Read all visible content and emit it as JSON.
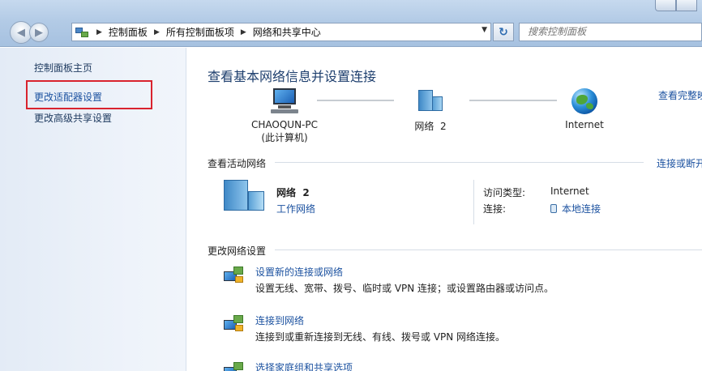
{
  "address_bar": {
    "breadcrumbs": [
      "控制面板",
      "所有控制面板项",
      "网络和共享中心"
    ]
  },
  "search": {
    "placeholder": "搜索控制面板"
  },
  "sidebar": {
    "home": "控制面板主页",
    "links": [
      "更改适配器设置",
      "更改高级共享设置"
    ]
  },
  "main": {
    "title": "查看基本网络信息并设置连接",
    "view_full_map": "查看完整映",
    "map": {
      "computer_name": "CHAOQUN-PC",
      "computer_sub": "(此计算机)",
      "network": "网络  2",
      "internet": "Internet"
    },
    "active_networks": {
      "heading": "查看活动网络",
      "connect_link": "连接或断开",
      "network_name": "网络  2",
      "network_type": "工作网络",
      "access_type_label": "访问类型:",
      "access_type_value": "Internet",
      "connections_label": "连接:",
      "connections_value": "本地连接"
    },
    "change_settings": {
      "heading": "更改网络设置",
      "tasks": [
        {
          "link": "设置新的连接或网络",
          "desc": "设置无线、宽带、拨号、临时或 VPN 连接；或设置路由器或访问点。"
        },
        {
          "link": "连接到网络",
          "desc": "连接到或重新连接到无线、有线、拨号或 VPN 网络连接。"
        },
        {
          "link": "选择家庭组和共享选项",
          "desc": ""
        }
      ]
    }
  },
  "colors": {
    "link": "#1c52a0",
    "highlight": "#d9232e",
    "title": "#1e3f6e"
  }
}
